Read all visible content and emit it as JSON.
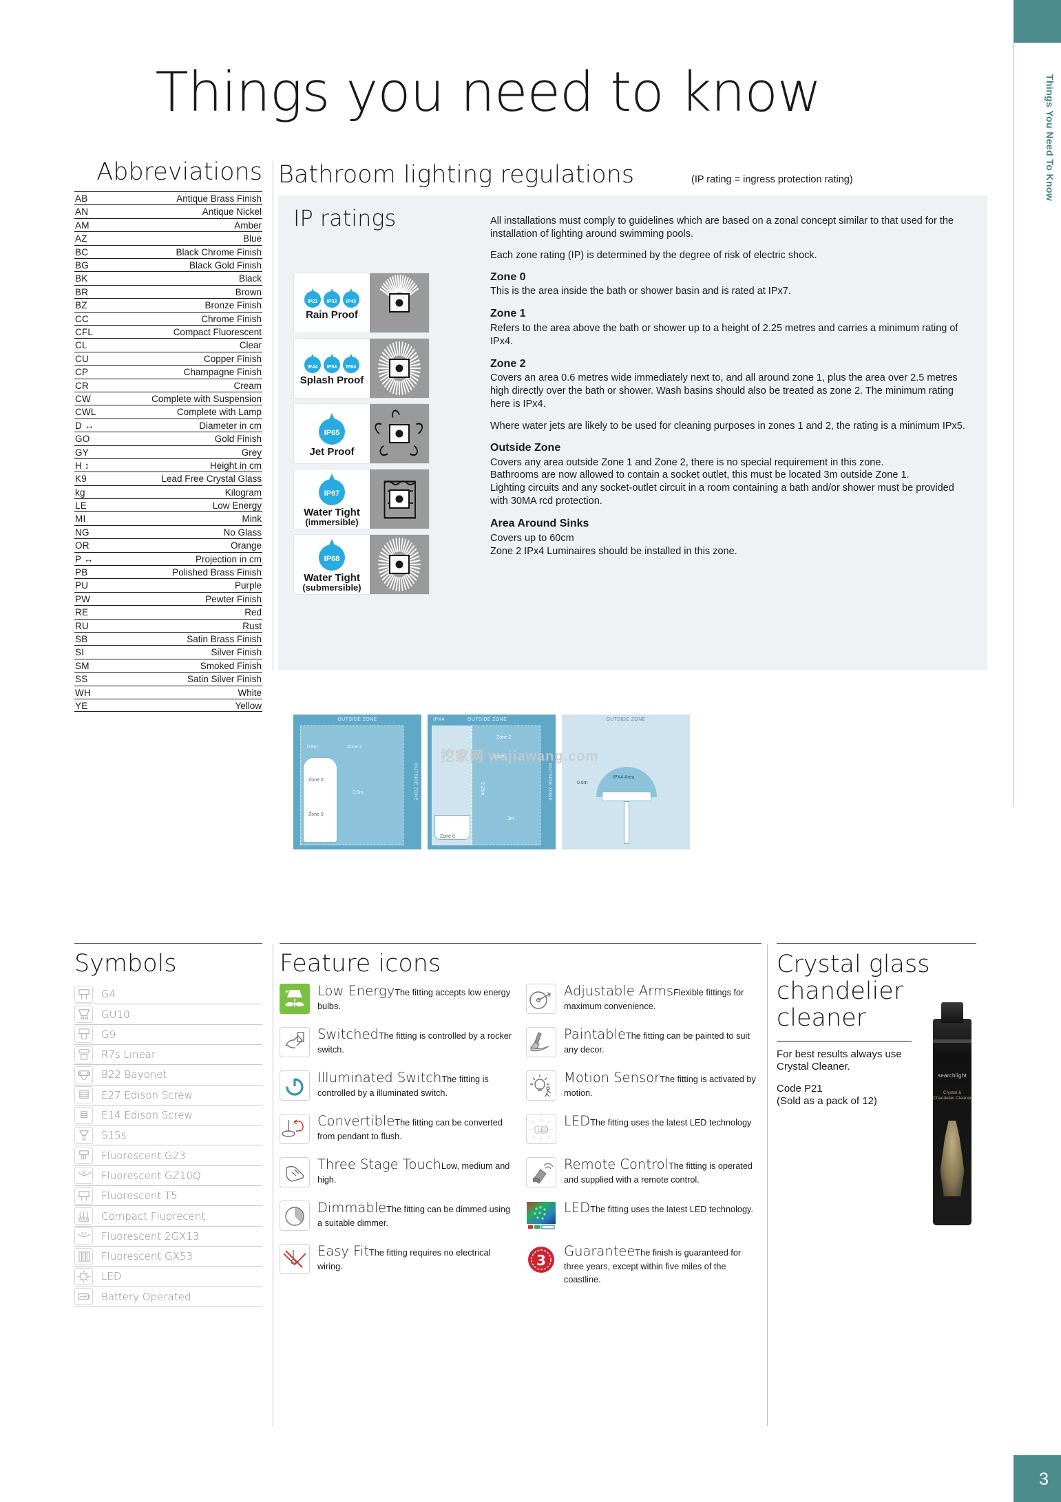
{
  "page": {
    "title": "Things you need to know",
    "side_tab_label": "Things You Need To Know",
    "page_number": "3"
  },
  "abbreviations": {
    "heading": "Abbreviations",
    "rows": [
      {
        "code": "AB",
        "meaning": "Antique Brass Finish"
      },
      {
        "code": "AN",
        "meaning": "Antique Nickel"
      },
      {
        "code": "AM",
        "meaning": "Amber"
      },
      {
        "code": "AZ",
        "meaning": "Blue"
      },
      {
        "code": "BC",
        "meaning": "Black Chrome Finish"
      },
      {
        "code": "BG",
        "meaning": "Black Gold Finish"
      },
      {
        "code": "BK",
        "meaning": "Black"
      },
      {
        "code": "BR",
        "meaning": "Brown"
      },
      {
        "code": "BZ",
        "meaning": "Bronze Finish"
      },
      {
        "code": "CC",
        "meaning": "Chrome Finish"
      },
      {
        "code": "CFL",
        "meaning": "Compact Fluorescent"
      },
      {
        "code": "CL",
        "meaning": "Clear"
      },
      {
        "code": "CU",
        "meaning": "Copper Finish"
      },
      {
        "code": "CP",
        "meaning": "Champagne Finish"
      },
      {
        "code": "CR",
        "meaning": "Cream"
      },
      {
        "code": "CW",
        "meaning": "Complete with Suspension"
      },
      {
        "code": "CWL",
        "meaning": "Complete with Lamp"
      },
      {
        "code": "D ↔",
        "meaning": "Diameter in cm"
      },
      {
        "code": "GO",
        "meaning": "Gold Finish"
      },
      {
        "code": "GY",
        "meaning": "Grey"
      },
      {
        "code": "H ↕",
        "meaning": "Height in cm"
      },
      {
        "code": "K9",
        "meaning": "Lead Free Crystal Glass"
      },
      {
        "code": "kg",
        "meaning": "Kilogram"
      },
      {
        "code": "LE",
        "meaning": "Low Energy"
      },
      {
        "code": "MI",
        "meaning": "Mink"
      },
      {
        "code": "NG",
        "meaning": "No Glass"
      },
      {
        "code": "OR",
        "meaning": "Orange"
      },
      {
        "code": "P ↔",
        "meaning": "Projection in cm"
      },
      {
        "code": "PB",
        "meaning": "Polished Brass Finish"
      },
      {
        "code": "PU",
        "meaning": "Purple"
      },
      {
        "code": "PW",
        "meaning": "Pewter Finish"
      },
      {
        "code": "RE",
        "meaning": "Red"
      },
      {
        "code": "RU",
        "meaning": "Rust"
      },
      {
        "code": "SB",
        "meaning": "Satin Brass Finish"
      },
      {
        "code": "SI",
        "meaning": "Silver Finish"
      },
      {
        "code": "SM",
        "meaning": "Smoked Finish"
      },
      {
        "code": "SS",
        "meaning": "Satin Silver Finish"
      },
      {
        "code": "WH",
        "meaning": "White"
      },
      {
        "code": "YE",
        "meaning": "Yellow"
      }
    ]
  },
  "regulations": {
    "heading": "Bathroom lighting regulations",
    "subheading": "(IP rating = ingress protection rating)",
    "ip_heading": "IP ratings",
    "ip_boxes": [
      {
        "label": "Rain Proof",
        "sub": "",
        "ratings": [
          "IP23",
          "IP33",
          "IP43"
        ],
        "style": "three"
      },
      {
        "label": "Splash Proof",
        "sub": "",
        "ratings": [
          "IP44",
          "IP54",
          "IP64"
        ],
        "style": "three"
      },
      {
        "label": "Jet Proof",
        "sub": "",
        "ratings": [
          "IP65"
        ],
        "style": "one"
      },
      {
        "label": "Water Tight",
        "sub": "(immersible)",
        "ratings": [
          "IP67"
        ],
        "style": "one"
      },
      {
        "label": "Water Tight",
        "sub": "(submersible)",
        "ratings": [
          "IP68"
        ],
        "style": "one"
      }
    ],
    "intro": [
      "All installations must comply to guidelines which are based on a zonal concept similar to that used for the installation of lighting around swimming pools.",
      "Each zone rating (IP) is determined by the degree of risk of electric shock."
    ],
    "zones": [
      {
        "title": "Zone 0",
        "body": "This is the area inside the bath or shower basin and is rated at IPx7."
      },
      {
        "title": "Zone 1",
        "body": "Refers to the area above the bath or shower up to a height of 2.25 metres and carries a minimum rating of IPx4."
      },
      {
        "title": "Zone 2",
        "body": "Covers an area 0.6 metres wide immediately next to, and all around zone 1, plus the area over 2.5 metres high directly over the bath or shower. Wash basins should also be treated as zone 2. The minimum rating here is IPx4."
      }
    ],
    "zone2_note": "Where water jets are likely to be used for cleaning purposes in zones 1 and 2, the rating is a minimum IPx5.",
    "outside_zone": {
      "title": "Outside Zone",
      "lines": [
        "Covers any area outside Zone 1 and Zone 2, there is no special requirement in this zone.",
        "Bathrooms are now allowed to contain a socket outlet, this must be located 3m outside Zone 1.",
        "Lighting circuits and any socket-outlet circuit in a room containing a bath and/or shower must be provided with 30MA rcd protection."
      ]
    },
    "sinks": {
      "title": "Area Around Sinks",
      "lines": [
        "Covers up to 60cm",
        "Zone 2 IPx4 Luminaires should be installed in this zone."
      ]
    },
    "diagrams": {
      "watermark": "挖家网 wajiawang.com",
      "d1": {
        "top_label": "OUTSIDE ZONE",
        "side_label": "OUTSIDE ZONE",
        "labels": [
          "0.6m",
          "Zone 2",
          "Zone 0",
          "Zone 0",
          "0.6m"
        ]
      },
      "d2": {
        "top_label_left": "IPX4",
        "top_label": "OUTSIDE ZONE",
        "side_label": "OUTSIDE ZONE",
        "labels": [
          "Zone 2",
          "0.6m",
          "2.25m",
          "3m",
          "Zone 0"
        ]
      },
      "d3": {
        "top_label": "OUTSIDE ZONE",
        "labels": [
          "IPX4 Area",
          "0.6m"
        ]
      }
    }
  },
  "symbols": {
    "heading": "Symbols",
    "rows": [
      {
        "label": "G4",
        "icon": "lamp-cap-g4-icon"
      },
      {
        "label": "GU10",
        "icon": "lamp-cap-gu10-icon"
      },
      {
        "label": "G9",
        "icon": "lamp-cap-g9-icon"
      },
      {
        "label": "R7s Linear",
        "icon": "lamp-cap-r7s-icon"
      },
      {
        "label": "B22 Bayonet",
        "icon": "lamp-cap-b22-icon"
      },
      {
        "label": "E27 Edison Screw",
        "icon": "lamp-cap-e27-icon"
      },
      {
        "label": "E14 Edison Screw",
        "icon": "lamp-cap-e14-icon"
      },
      {
        "label": "S15s",
        "icon": "lamp-cap-s15s-icon"
      },
      {
        "label": "Fluorescent G23",
        "icon": "lamp-cap-g23-icon"
      },
      {
        "label": "Fluorescent GZ10Q",
        "icon": "lamp-cap-gz10q-icon"
      },
      {
        "label": "Fluorescent T5",
        "icon": "lamp-cap-t5-icon"
      },
      {
        "label": "Compact Fluorecent",
        "icon": "lamp-cap-cfl-icon"
      },
      {
        "label": "Fluorescent 2GX13",
        "icon": "lamp-cap-2gx13-icon"
      },
      {
        "label": "Fluorescent GX53",
        "icon": "lamp-cap-gx53-icon"
      },
      {
        "label": "LED",
        "icon": "lamp-cap-led-icon"
      },
      {
        "label": "Battery Operated",
        "icon": "battery-icon"
      }
    ]
  },
  "features": {
    "heading": "Feature icons",
    "left": [
      {
        "title": "Low Energy",
        "desc": "The fitting accepts low energy bulbs.",
        "icon": "low-energy-icon"
      },
      {
        "title": "Switched",
        "desc": "The fitting is controlled by a rocker switch.",
        "icon": "switched-icon"
      },
      {
        "title": "Illuminated Switch",
        "desc": "The fitting is controlled by a illuminated switch.",
        "icon": "illuminated-switch-icon"
      },
      {
        "title": "Convertible",
        "desc": "The fitting can be converted from pendant to flush.",
        "icon": "convertible-icon"
      },
      {
        "title": "Three Stage Touch",
        "desc": "Low, medium and high.",
        "icon": "three-stage-touch-icon"
      },
      {
        "title": "Dimmable",
        "desc": "The fitting can be dimmed using a suitable dimmer.",
        "icon": "dimmable-icon"
      },
      {
        "title": "Easy Fit",
        "desc": "The fitting requires no electrical wiring.",
        "icon": "easy-fit-icon"
      }
    ],
    "right": [
      {
        "title": "Adjustable Arms",
        "desc": "Flexible fittings for maximum convenience.",
        "icon": "adjustable-arms-icon"
      },
      {
        "title": "Paintable",
        "desc": "The fitting can be painted to suit any decor.",
        "icon": "paintable-icon"
      },
      {
        "title": "Motion Sensor",
        "desc": "The fitting is activated by motion.",
        "icon": "motion-sensor-icon"
      },
      {
        "title": "LED",
        "desc": "The fitting uses the latest LED technology",
        "icon": "led-icon"
      },
      {
        "title": "Remote Control",
        "desc": "The fitting is operated and supplied with a remote control.",
        "icon": "remote-control-icon"
      },
      {
        "title": "LED",
        "desc": "The fitting uses the latest LED technology.",
        "icon": "led-technology-icon"
      },
      {
        "title": "Guarantee",
        "desc": "The finish is guaranteed for three years, except within five miles of the coastline.",
        "icon": "guarantee-3-year-icon"
      }
    ]
  },
  "cleaner": {
    "heading": "Crystal glass chandelier cleaner",
    "line1": "For best results always use Crystal Cleaner.",
    "line2": "Code P21",
    "line3": "(Sold as a pack of 12)",
    "bottle_brand": "searchlight",
    "bottle_sub": "Crystal & Chandelier Cleaner"
  },
  "colors": {
    "teal": "#4d8c8c",
    "panel": "#eef2f4",
    "drop_blue": "#29abe2",
    "green": "#7ac143",
    "diagram_blue": "#5fa8c8"
  }
}
